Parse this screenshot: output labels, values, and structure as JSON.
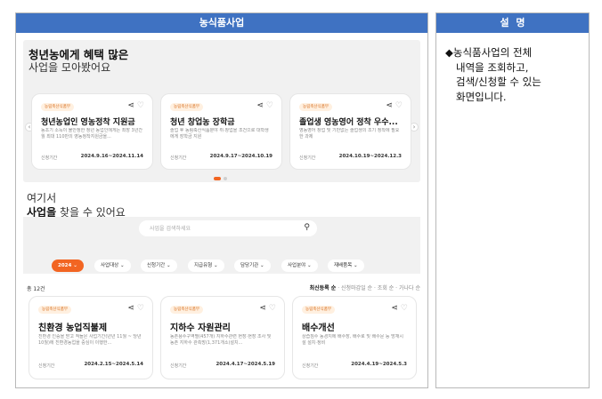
{
  "main_panel": {
    "title": "농식품사업"
  },
  "side_panel": {
    "title": "설  명",
    "bullet": "◆",
    "lines": [
      "농식품사업의 전체",
      "내역을 조회하고,",
      "검색/신청할 수 있는",
      "화면입니다."
    ]
  },
  "promo": {
    "title": "청년농에게 혜택 많은",
    "subtitle": "사업을 모아봤어요",
    "cards": [
      {
        "badge": "농림축산식품부",
        "title": "청년농업인 영농정착 지원금",
        "desc": "농초기 소득이 불안정한 청년 농업인에게는 최장 3년간 월 최대 110만의 영농정착지원금을...",
        "period_label": "신청기간",
        "period": "2024.9.16~2024.11.14"
      },
      {
        "badge": "농림축산식품부",
        "title": "청년 창업농 장학금",
        "desc": "졸업 후 농림축산식품분야 취·창업을 조건으로 대학생에게 장학금 지원",
        "period_label": "신청기간",
        "period": "2024.9.17~2024.10.19"
      },
      {
        "badge": "농림축산식품부",
        "title": "졸업생 영농영어 정착 우수...",
        "desc": "영농영어 창업 및 기반없는 졸업생의 조기 정착에 필요한 과제",
        "period_label": "신청기간",
        "period": "2024.10.19~2024.12.3"
      }
    ]
  },
  "section2": {
    "line1": "여기서",
    "line2_bold": "사업을",
    "line2_rest": " 찾을 수 있어요"
  },
  "search": {
    "placeholder": "사업을 검색하세요",
    "icon": "search-icon"
  },
  "filters": [
    {
      "label": "2024",
      "active": true
    },
    {
      "label": "사업대상",
      "active": false
    },
    {
      "label": "신청기간",
      "active": false
    },
    {
      "label": "지급유형",
      "active": false
    },
    {
      "label": "담당기관",
      "active": false
    },
    {
      "label": "사업분야",
      "active": false
    },
    {
      "label": "재배품목",
      "active": false
    }
  ],
  "results": {
    "total": "총 12건",
    "sorts": [
      "최신등록 순",
      "신청마감일 순",
      "조회 순",
      "가나다 순"
    ],
    "sort_sep": " · ",
    "cards": [
      {
        "badge": "농림축산식품부",
        "title": "친환경 농업직불제",
        "desc": "친환경 인증을 받고 적들은 사업기간(년년 11월 ~ 당년 10월)에 친환경농업을 중심이 이행한...",
        "period_label": "신청기간",
        "period": "2024.2.15~2024.5.14"
      },
      {
        "badge": "농림축산식품부",
        "title": "지하수 자원관리",
        "desc": "농촌용수구역별(457개) 지하수관련 현장·현장 조사 및 농촌 지하수 관측망(1,371개소)설치...",
        "period_label": "신청기간",
        "period": "2024.4.17~2024.5.19"
      },
      {
        "badge": "농림축산식품부",
        "title": "배수개선",
        "desc": "상습침수 농경지에 배수장, 배수로 및 배수문 등 방재시설 설치·정비",
        "period_label": "신청기간",
        "period": "2024.4.19~2024.5.3"
      }
    ]
  },
  "icons": {
    "share": "share-icon",
    "heart": "heart-icon",
    "prev": "chevron-left-icon",
    "next": "chevron-right-icon",
    "dropdown": "chevron-down-icon"
  },
  "colors": {
    "header": "#3f72c2",
    "accent": "#f26522",
    "band": "#f1f1f1"
  }
}
